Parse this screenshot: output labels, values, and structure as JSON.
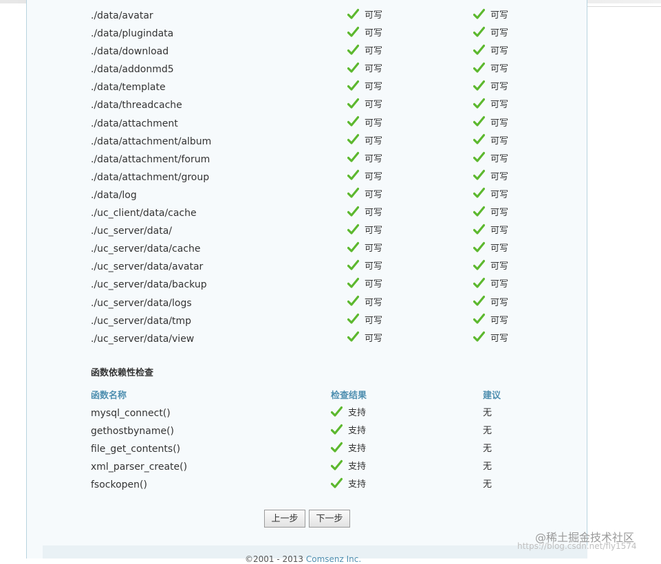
{
  "directories": [
    {
      "path": "./data/avatar",
      "current": "可写",
      "required": "可写"
    },
    {
      "path": "./data/plugindata",
      "current": "可写",
      "required": "可写"
    },
    {
      "path": "./data/download",
      "current": "可写",
      "required": "可写"
    },
    {
      "path": "./data/addonmd5",
      "current": "可写",
      "required": "可写"
    },
    {
      "path": "./data/template",
      "current": "可写",
      "required": "可写"
    },
    {
      "path": "./data/threadcache",
      "current": "可写",
      "required": "可写"
    },
    {
      "path": "./data/attachment",
      "current": "可写",
      "required": "可写"
    },
    {
      "path": "./data/attachment/album",
      "current": "可写",
      "required": "可写"
    },
    {
      "path": "./data/attachment/forum",
      "current": "可写",
      "required": "可写"
    },
    {
      "path": "./data/attachment/group",
      "current": "可写",
      "required": "可写"
    },
    {
      "path": "./data/log",
      "current": "可写",
      "required": "可写"
    },
    {
      "path": "./uc_client/data/cache",
      "current": "可写",
      "required": "可写"
    },
    {
      "path": "./uc_server/data/",
      "current": "可写",
      "required": "可写"
    },
    {
      "path": "./uc_server/data/cache",
      "current": "可写",
      "required": "可写"
    },
    {
      "path": "./uc_server/data/avatar",
      "current": "可写",
      "required": "可写"
    },
    {
      "path": "./uc_server/data/backup",
      "current": "可写",
      "required": "可写"
    },
    {
      "path": "./uc_server/data/logs",
      "current": "可写",
      "required": "可写"
    },
    {
      "path": "./uc_server/data/tmp",
      "current": "可写",
      "required": "可写"
    },
    {
      "path": "./uc_server/data/view",
      "current": "可写",
      "required": "可写"
    }
  ],
  "function_check": {
    "title": "函数依赖性检查",
    "headers": {
      "name": "函数名称",
      "result": "检查结果",
      "suggestion": "建议"
    },
    "rows": [
      {
        "name": "mysql_connect()",
        "result": "支持",
        "suggestion": "无"
      },
      {
        "name": "gethostbyname()",
        "result": "支持",
        "suggestion": "无"
      },
      {
        "name": "file_get_contents()",
        "result": "支持",
        "suggestion": "无"
      },
      {
        "name": "xml_parser_create()",
        "result": "支持",
        "suggestion": "无"
      },
      {
        "name": "fsockopen()",
        "result": "支持",
        "suggestion": "无"
      }
    ]
  },
  "buttons": {
    "prev": "上一步",
    "next": "下一步"
  },
  "footer": {
    "copyright": "©2001 - 2013 ",
    "company": "Comsenz Inc."
  },
  "watermark": {
    "main": "@稀土掘金技术社区",
    "url": "https://blog.csdn.net/fly1574"
  },
  "colors": {
    "check": "#5cb82e",
    "header": "#4f8fb0",
    "panel_bg": "#f6fafc"
  },
  "icons": {
    "status": "check-icon"
  }
}
